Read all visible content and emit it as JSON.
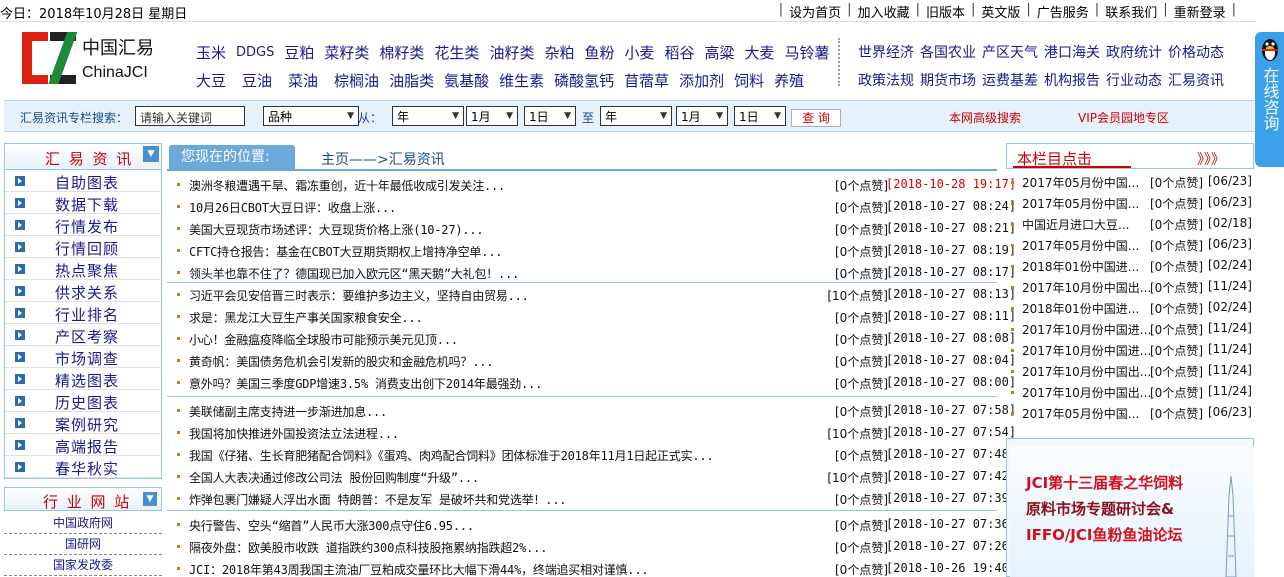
{
  "topbar": {
    "date": "今日：2018年10月28日 星期日",
    "links": [
      "设为首页",
      "加入收藏",
      "旧版本",
      "英文版",
      "广告服务",
      "联系我们",
      "重新登录"
    ]
  },
  "logo": {
    "cn": "中国汇易",
    "en": "ChinaJCI"
  },
  "commodities": {
    "row1": [
      "玉米",
      "DDGS",
      "豆粕",
      "菜籽类",
      "棉籽类",
      "花生类",
      "油籽类",
      "杂粕",
      "鱼粉",
      "小麦",
      "稻谷",
      "高粱",
      "大麦",
      "马铃薯"
    ],
    "row2": [
      "大豆",
      "豆油",
      "菜油",
      "棕榈油",
      "油脂类",
      "氨基酸",
      "维生素",
      "磷酸氢钙",
      "苜蓿草",
      "添加剂",
      "饲料",
      "养殖"
    ]
  },
  "policy": {
    "row1": [
      "世界经济",
      "各国农业",
      "产区天气",
      "港口海关",
      "政府统计",
      "价格动态"
    ],
    "row2": [
      "政策法规",
      "期货市场",
      "运费基差",
      "机构报告",
      "行业动态",
      "汇易资讯"
    ]
  },
  "consult": {
    "text": "在线咨询",
    "icon": "qq-penguin-icon"
  },
  "search": {
    "label": "汇易资讯专栏搜索：",
    "keyword_value": "请输入关键词",
    "category": "品种",
    "from_label": "从：",
    "to_label": "至",
    "from": {
      "year": "年",
      "month": "1月",
      "day": "1日"
    },
    "to": {
      "year": "年",
      "month": "1月",
      "day": "1日"
    },
    "button": "查 询",
    "advanced": "本网高级搜索",
    "vip": "VIP会员园地专区"
  },
  "left": {
    "title": "汇 易 资 讯",
    "items": [
      "自助图表",
      "数据下载",
      "行情发布",
      "行情回顾",
      "热点聚焦",
      "供求关系",
      "行业排名",
      "产区考察",
      "市场调查",
      "精选图表",
      "历史图表",
      "案例研究",
      "高端报告",
      "春华秋实"
    ],
    "sites_title": "行 业 网 站",
    "sites": [
      "中国政府网",
      "国研网",
      "国家发改委"
    ]
  },
  "main": {
    "position_label": "您现在的位置:",
    "breadcrumb": "主页——>汇易资讯",
    "groups": [
      [
        {
          "title": "澳洲冬粮遭遇干旱、霜冻重创，近十年最低收成引发关注...",
          "count": "[0个点赞]",
          "date": "[2018-10-28 19:17]",
          "red": true
        },
        {
          "title": "10月26日CBOT大豆日评：收盘上涨...",
          "count": "[0个点赞]",
          "date": "[2018-10-27 08:24]",
          "red": false
        },
        {
          "title": "美国大豆现货市场述评：大豆现货价格上涨(10-27)...",
          "count": "[0个点赞]",
          "date": "[2018-10-27 08:21]",
          "red": false
        },
        {
          "title": "CFTC持仓报告：基金在CBOT大豆期货期权上增持净空单...",
          "count": "[0个点赞]",
          "date": "[2018-10-27 08:19]",
          "red": false
        },
        {
          "title": "领头羊也靠不住了？德国现已加入欧元区“黑天鹅”大礼包！...",
          "count": "[0个点赞]",
          "date": "[2018-10-27 08:17]",
          "red": false
        }
      ],
      [
        {
          "title": "习近平会见安倍晋三时表示：要维护多边主义，坚持自由贸易...",
          "count": "[10个点赞]",
          "date": "[2018-10-27 08:13]",
          "red": false
        },
        {
          "title": "求是：黑龙江大豆生产事关国家粮食安全...",
          "count": "[0个点赞]",
          "date": "[2018-10-27 08:11]",
          "red": false
        },
        {
          "title": "小心！金融瘟疫降临全球股市可能预示美元见顶...",
          "count": "[0个点赞]",
          "date": "[2018-10-27 08:08]",
          "red": false
        },
        {
          "title": "黄奇帆：美国债务危机会引发新的股灾和金融危机吗？...",
          "count": "[0个点赞]",
          "date": "[2018-10-27 08:04]",
          "red": false
        },
        {
          "title": "意外吗？美国三季度GDP增速3.5% 消费支出创下2014年最强劲...",
          "count": "[0个点赞]",
          "date": "[2018-10-27 08:00]",
          "red": false
        }
      ],
      [
        {
          "title": "美联储副主席支持进一步渐进加息...",
          "count": "[0个点赞]",
          "date": "[2018-10-27 07:58]",
          "red": false
        },
        {
          "title": "我国将加快推进外国投资法立法进程...",
          "count": "[10个点赞]",
          "date": "[2018-10-27 07:54]",
          "red": false
        },
        {
          "title": "我国《仔猪、生长育肥猪配合饲料》《蛋鸡、肉鸡配合饲料》团体标准于2018年11月1日起正式实...",
          "count": "[0个点赞]",
          "date": "[2018-10-27 07:48]",
          "red": false
        },
        {
          "title": "全国人大表决通过修改公司法 股份回购制度“升级”...",
          "count": "[10个点赞]",
          "date": "[2018-10-27 07:42]",
          "red": false
        },
        {
          "title": "炸弹包裹门嫌疑人浮出水面 特朗普：不是友军 是破坏共和党选举！...",
          "count": "[0个点赞]",
          "date": "[2018-10-27 07:39]",
          "red": false
        }
      ],
      [
        {
          "title": "央行警告、空头“缩首”人民币大涨300点守住6.95...",
          "count": "[0个点赞]",
          "date": "[2018-10-27 07:36]",
          "red": false
        },
        {
          "title": "隔夜外盘：欧美股市收跌 道指跌约300点科技股拖累纳指跌超2%...",
          "count": "[0个点赞]",
          "date": "[2018-10-27 07:26]",
          "red": false
        },
        {
          "title": "JCI：2018年第43周我国主流油厂豆粕成交量环比大幅下滑44%，终端追买相对谨慎...",
          "count": "[0个点赞]",
          "date": "[2018-10-26 19:40]",
          "red": false
        }
      ]
    ]
  },
  "right": {
    "title": "本栏目点击",
    "more": "》》》",
    "items": [
      {
        "t": "2017年05月份中国...",
        "c": "[0个点赞]",
        "d": "[06/23]"
      },
      {
        "t": "2017年05月份中国...",
        "c": "[0个点赞]",
        "d": "[06/23]"
      },
      {
        "t": "中国近月进口大豆...",
        "c": "[0个点赞]",
        "d": "[02/18]"
      },
      {
        "t": "2017年05月份中国...",
        "c": "[0个点赞]",
        "d": "[06/23]"
      },
      {
        "t": "2018年01份中国进...",
        "c": "[0个点赞]",
        "d": "[02/24]"
      },
      {
        "t": "2017年10月份中国出...",
        "c": "[0个点赞]",
        "d": "[11/24]"
      },
      {
        "t": "2018年01份中国进...",
        "c": "[0个点赞]",
        "d": "[02/24]"
      },
      {
        "t": "2017年10月份中国进...",
        "c": "[0个点赞]",
        "d": "[11/24]"
      },
      {
        "t": "2017年10月份中国进...",
        "c": "[0个点赞]",
        "d": "[11/24]"
      },
      {
        "t": "2017年10月份中国出...",
        "c": "[0个点赞]",
        "d": "[11/24]"
      },
      {
        "t": "2017年10月份中国出...",
        "c": "[0个点赞]",
        "d": "[11/24]"
      },
      {
        "t": "2017年05月份中国...",
        "c": "[0个点赞]",
        "d": "[06/23]"
      }
    ],
    "banner": [
      "JCI第十三届春之华饲料",
      "原料市场专题研讨会&",
      "IFFO/JCI鱼粉鱼油论坛"
    ]
  },
  "colors": {
    "link": "#1a1a8c",
    "accent_red": "#cc0000",
    "header_blue": "#6aa9d9",
    "consult_blue": "#3aa0e8"
  }
}
